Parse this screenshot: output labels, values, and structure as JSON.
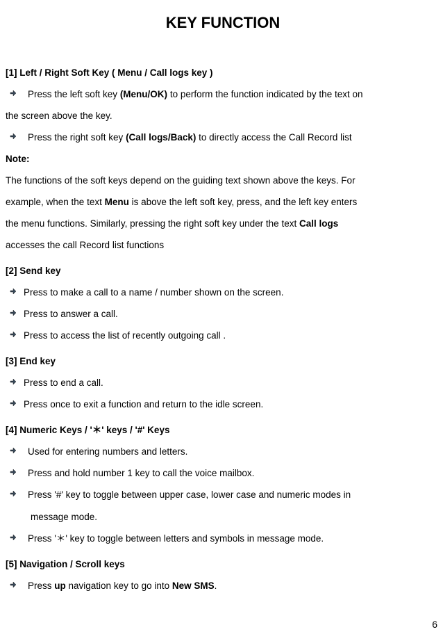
{
  "title": "KEY FUNCTION",
  "page_number": "6",
  "sections": {
    "s1": {
      "head": "[1]   Left  /  Right  Soft  Key  (  Menu  /  Call logs  key  )",
      "b1a": "Press the left soft key ",
      "b1b": "(Menu/OK)",
      "b1c": " to perform the function indicated by the text on",
      "b1d": "the screen above the key.",
      "b2a": "Press the right soft key ",
      "b2b": "(Call logs/Back)",
      "b2c": " to directly access the Call Record list",
      "note_label": "Note:",
      "note_l1a": "The functions of the soft keys depend on the guiding text shown above the keys. For",
      "note_l2a": "example, when the text ",
      "note_l2b": "Menu",
      "note_l2c": " is above the left soft key, press, and the left key enters",
      "note_l3a": "the  menu  functions.  Similarly,  pressing  the  right  soft  key  under  the  text  ",
      "note_l3b": "Call  logs",
      "note_l4": "accesses the call Record list functions"
    },
    "s2": {
      "head": "[2]   Send  key",
      "b1": "Press to make a call to a name / number shown on the screen.",
      "b2": "Press to answer a call.",
      "b3": "Press to access the list of recently outgoing call ."
    },
    "s3": {
      "head": "[3]   End  key",
      "b1": "Press to end a call.",
      "b2": "Press once to exit a function and return to the idle screen."
    },
    "s4": {
      "head": "[4]   Numeric  Keys  /  '＊'  keys  /  '#'  Keys",
      "b1": "Used for entering numbers and letters.",
      "b2": "Press and hold number 1 key to call the voice mailbox.",
      "b3a": "Press '#' key to toggle between upper case, lower case and numeric modes in",
      "b3b": "message mode.",
      "b4": "Press '＊' key to toggle between letters and symbols in message mode."
    },
    "s5": {
      "head": "[5]   Navigation  /  Scroll  keys",
      "b1a": "Press ",
      "b1b": "up",
      "b1c": " navigation key to go into ",
      "b1d": "New SMS",
      "b1e": "."
    }
  }
}
